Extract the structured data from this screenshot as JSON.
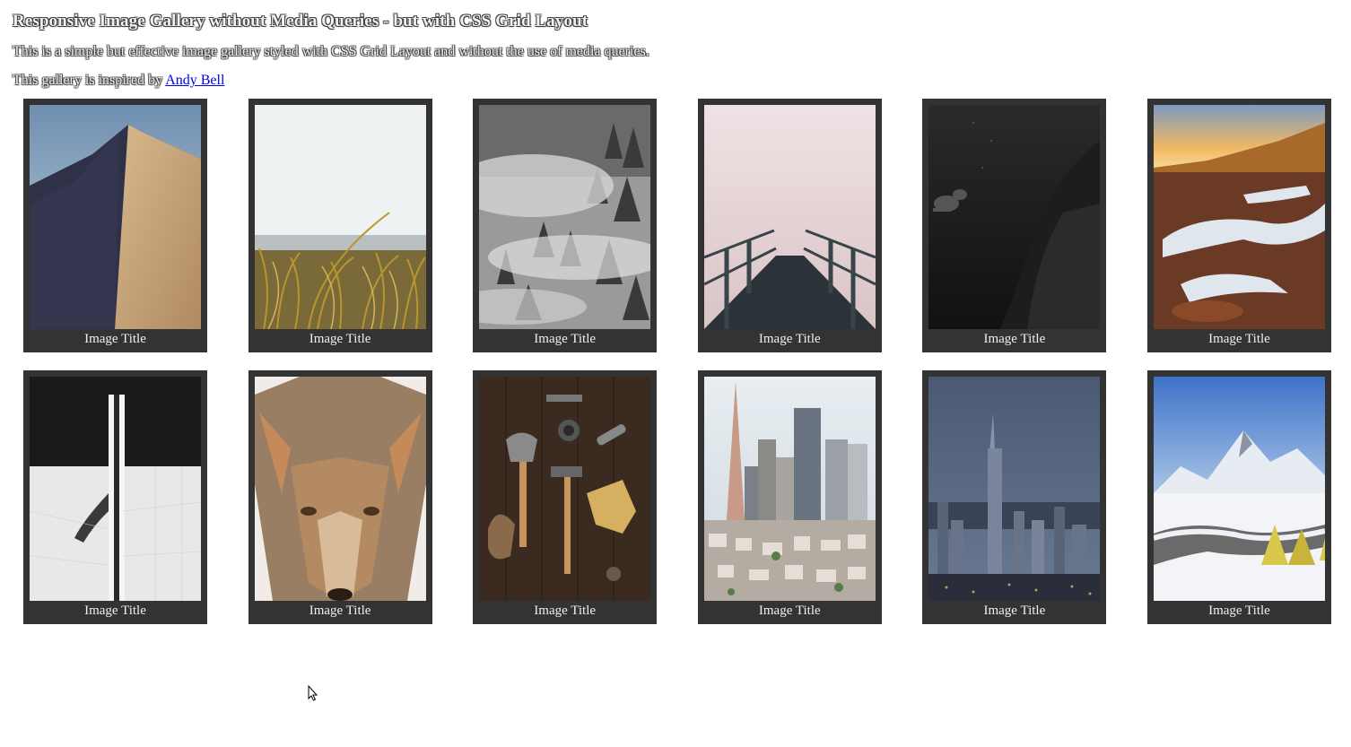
{
  "page": {
    "title": "Responsive Image Gallery without Media Queries - but with CSS Grid Layout",
    "intro": "This is a simple but effective image gallery styled with CSS Grid Layout and without the use of media queries.",
    "credit_prefix": "This gallery is inspired by ",
    "credit_link": "Andy Bell"
  },
  "gallery": {
    "items": [
      {
        "caption": "Image Title",
        "icon": "sand-dune-photo"
      },
      {
        "caption": "Image Title",
        "icon": "beach-grass-photo"
      },
      {
        "caption": "Image Title",
        "icon": "foggy-forest-photo"
      },
      {
        "caption": "Image Title",
        "icon": "foggy-bridge-photo"
      },
      {
        "caption": "Image Title",
        "icon": "scuba-diver-photo"
      },
      {
        "caption": "Image Title",
        "icon": "snowy-sunset-hill-photo"
      },
      {
        "caption": "Image Title",
        "icon": "architecture-photo"
      },
      {
        "caption": "Image Title",
        "icon": "coyote-photo"
      },
      {
        "caption": "Image Title",
        "icon": "tools-photo"
      },
      {
        "caption": "Image Title",
        "icon": "san-francisco-city-photo"
      },
      {
        "caption": "Image Title",
        "icon": "city-skyline-dusk-photo"
      },
      {
        "caption": "Image Title",
        "icon": "snowy-mountain-camp-photo"
      }
    ]
  },
  "colors": {
    "card_background": "#333333",
    "caption_text": "#f0f0f0",
    "link": "#0000ee"
  }
}
